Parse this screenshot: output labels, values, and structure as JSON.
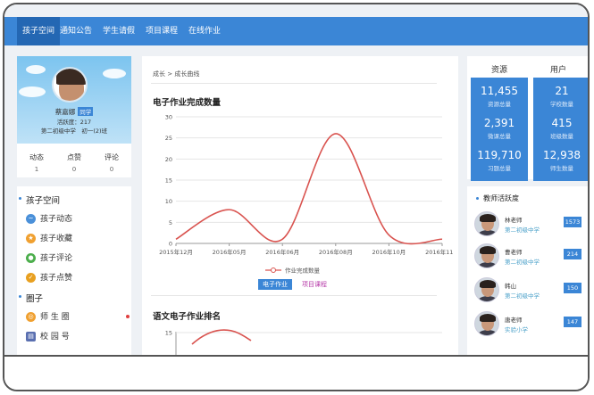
{
  "nav": {
    "items": [
      "孩子空间",
      "通知公告",
      "学生请假",
      "项目课程",
      "在线作业"
    ],
    "active_index": 0
  },
  "profile": {
    "name": "蔡嘉娜",
    "role_tag": "同学",
    "activity": "活跃度：217",
    "school_class": "第二初级中学　初一(2)班",
    "stats": [
      {
        "label": "动态",
        "value": "1"
      },
      {
        "label": "点赞",
        "value": "0"
      },
      {
        "label": "评论",
        "value": "0"
      }
    ]
  },
  "sidebar": {
    "section1": {
      "title": "孩子空间",
      "items": [
        {
          "label": "孩子动态",
          "icon": "pulse-icon",
          "color": "#4a90d9"
        },
        {
          "label": "孩子收藏",
          "icon": "star-icon",
          "color": "#f0a030"
        },
        {
          "label": "孩子评论",
          "icon": "comment-icon",
          "color": "#4cae4c"
        },
        {
          "label": "孩子点赞",
          "icon": "thumbs-up-icon",
          "color": "#e8a020"
        }
      ]
    },
    "section2": {
      "title": "圈子",
      "items": [
        {
          "label": "师 生 圈",
          "icon": "people-icon",
          "color": "#f0a030"
        },
        {
          "label": "校 园 号",
          "icon": "building-icon",
          "color": "#5a6fb0"
        }
      ]
    }
  },
  "main": {
    "breadcrumb": "成长 > 成长曲线",
    "chart1_title": "电子作业完成数量",
    "chart2_title": "语文电子作业排名",
    "tabs": [
      {
        "label": "电子作业",
        "active": true
      },
      {
        "label": "项目课程",
        "active": false
      }
    ]
  },
  "chart_data": [
    {
      "type": "line",
      "title": "电子作业完成数量",
      "x": [
        "2015年12月",
        "2016年05月",
        "2016年06月",
        "2016年08月",
        "2016年10月",
        "2016年11月"
      ],
      "series": [
        {
          "name": "作业完成数量",
          "values": [
            1,
            8,
            1,
            26,
            2,
            1
          ]
        }
      ],
      "y_ticks": [
        0,
        5,
        10,
        15,
        20,
        25,
        30
      ],
      "ylim": [
        0,
        30
      ],
      "grid": true,
      "legend": "bottom",
      "color": "#d9534f"
    },
    {
      "type": "line",
      "title": "语文电子作业排名",
      "y_ticks": [
        15
      ],
      "partial": true,
      "color": "#d9534f"
    }
  ],
  "resources": {
    "head_left": "资源",
    "head_right": "用户",
    "tiles": [
      {
        "num": "11,455",
        "label": "资源总量"
      },
      {
        "num": "21",
        "label": "学校数量"
      },
      {
        "num": "2,391",
        "label": "微课总量"
      },
      {
        "num": "415",
        "label": "班级数量"
      },
      {
        "num": "119,710",
        "label": "习题总量"
      },
      {
        "num": "12,938",
        "label": "师生数量"
      }
    ]
  },
  "teachers": {
    "title": "教师活跃度",
    "list": [
      {
        "name": "林老师",
        "school": "第二初级中学",
        "score": "1573"
      },
      {
        "name": "曹老师",
        "school": "第二初级中学",
        "score": "214"
      },
      {
        "name": "韩山",
        "school": "第二初级中学",
        "score": "150"
      },
      {
        "name": "唐老师",
        "school": "实验小学",
        "score": "147"
      }
    ]
  }
}
